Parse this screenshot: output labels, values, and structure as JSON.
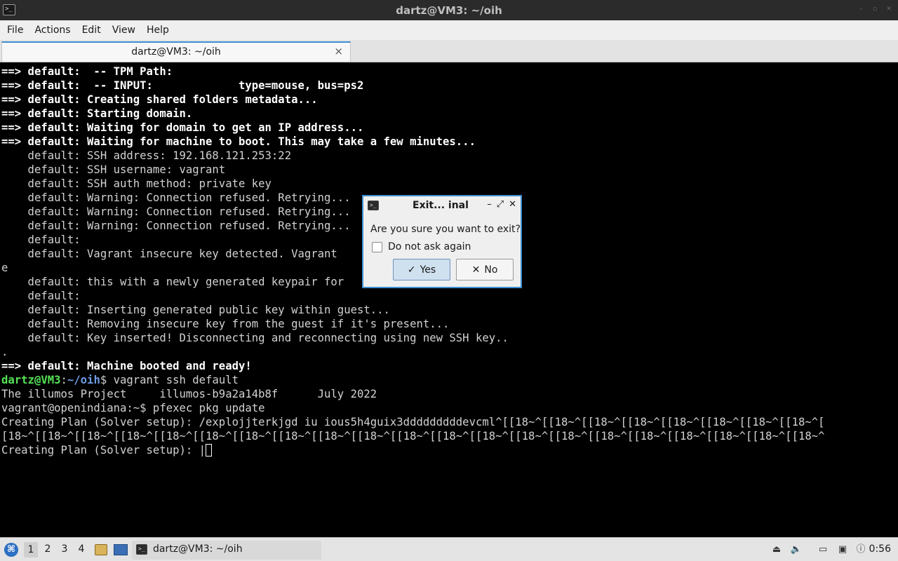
{
  "window": {
    "title": "dartz@VM3: ~/oih",
    "icon": "terminal-icon"
  },
  "menu": [
    "File",
    "Actions",
    "Edit",
    "View",
    "Help"
  ],
  "tab": {
    "label": "dartz@VM3: ~/oih",
    "close": "×"
  },
  "terminal": {
    "lines": [
      [
        [
          "b",
          "==> default:  -- TPM Path:"
        ]
      ],
      [
        [
          "b",
          "==> default:  -- INPUT:             type=mouse, bus=ps2"
        ]
      ],
      [
        [
          "b",
          "==> default: Creating shared folders metadata..."
        ]
      ],
      [
        [
          "b",
          "==> default: Starting domain."
        ]
      ],
      [
        [
          "b",
          "==> default: Waiting for domain to get an IP address..."
        ]
      ],
      [
        [
          "b",
          "==> default: Waiting for machine to boot. This may take a few minutes..."
        ]
      ],
      [
        [
          "n",
          "    default: SSH address: 192.168.121.253:22"
        ]
      ],
      [
        [
          "n",
          "    default: SSH username: vagrant"
        ]
      ],
      [
        [
          "n",
          "    default: SSH auth method: private key"
        ]
      ],
      [
        [
          "n",
          "    default: Warning: Connection refused. Retrying..."
        ]
      ],
      [
        [
          "n",
          "    default: Warning: Connection refused. Retrying..."
        ]
      ],
      [
        [
          "n",
          "    default: Warning: Connection refused. Retrying..."
        ]
      ],
      [
        [
          "n",
          "    default:"
        ]
      ],
      [
        [
          "n",
          "    default: Vagrant insecure key detected. Vagrant                     lac"
        ]
      ],
      [
        [
          "n",
          "e"
        ]
      ],
      [
        [
          "n",
          "    default: this with a newly generated keypair for"
        ]
      ],
      [
        [
          "n",
          "    default:"
        ]
      ],
      [
        [
          "n",
          "    default: Inserting generated public key within guest..."
        ]
      ],
      [
        [
          "n",
          "    default: Removing insecure key from the guest if it's present..."
        ]
      ],
      [
        [
          "n",
          "    default: Key inserted! Disconnecting and reconnecting using new SSH key.."
        ]
      ],
      [
        [
          "n",
          "."
        ]
      ],
      [
        [
          "b",
          "==> default: Machine booted and ready!"
        ]
      ],
      [
        [
          "g",
          "dartz@VM3"
        ],
        [
          "n",
          ":"
        ],
        [
          "bl",
          "~/oih"
        ],
        [
          "n",
          "$ vagrant ssh default"
        ]
      ],
      [
        [
          "n",
          "The illumos Project     illumos-b9a2a14b8f      July 2022"
        ]
      ],
      [
        [
          "n",
          "vagrant@openindiana:~$ pfexec pkg update"
        ]
      ],
      [
        [
          "n",
          "Creating Plan (Solver setup): /explojjterkjgd iu ious5h4guix3dddddddddevcml^[[18~^[[18~^[[18~^[[18~^[[18~^[[18~^[[18~^[[18~^["
        ]
      ],
      [
        [
          "n",
          "[18~^[[18~^[[18~^[[18~^[[18~^[[18~^[[18~^[[18~^[[18~^[[18~^[[18~^[[18~^[[18~^[[18~^[[18~^[[18~^[[18~^[[18~^[[18~^[[18~^[[18~^"
        ]
      ],
      [
        [
          "n",
          "Creating Plan (Solver setup): |"
        ]
      ]
    ]
  },
  "dialog": {
    "title": "Exit... inal",
    "icon": "terminal-icon",
    "message": "Are you sure you want to exit?",
    "checkbox_label": "Do not ask again",
    "checkbox_checked": false,
    "yes_label": "Yes",
    "no_label": "No",
    "yes_icon": "✓",
    "no_icon": "✕",
    "title_buttons": [
      "–",
      "⤢",
      "✕"
    ]
  },
  "taskbar": {
    "workspaces": [
      "1",
      "2",
      "3",
      "4"
    ],
    "active_workspace": "1",
    "task_label": "dartz@VM3: ~/oih",
    "clock": "0:56"
  },
  "colors": {
    "accent": "#3d8fd1",
    "prompt_user": "#55e355",
    "prompt_path": "#6f9ce5"
  }
}
